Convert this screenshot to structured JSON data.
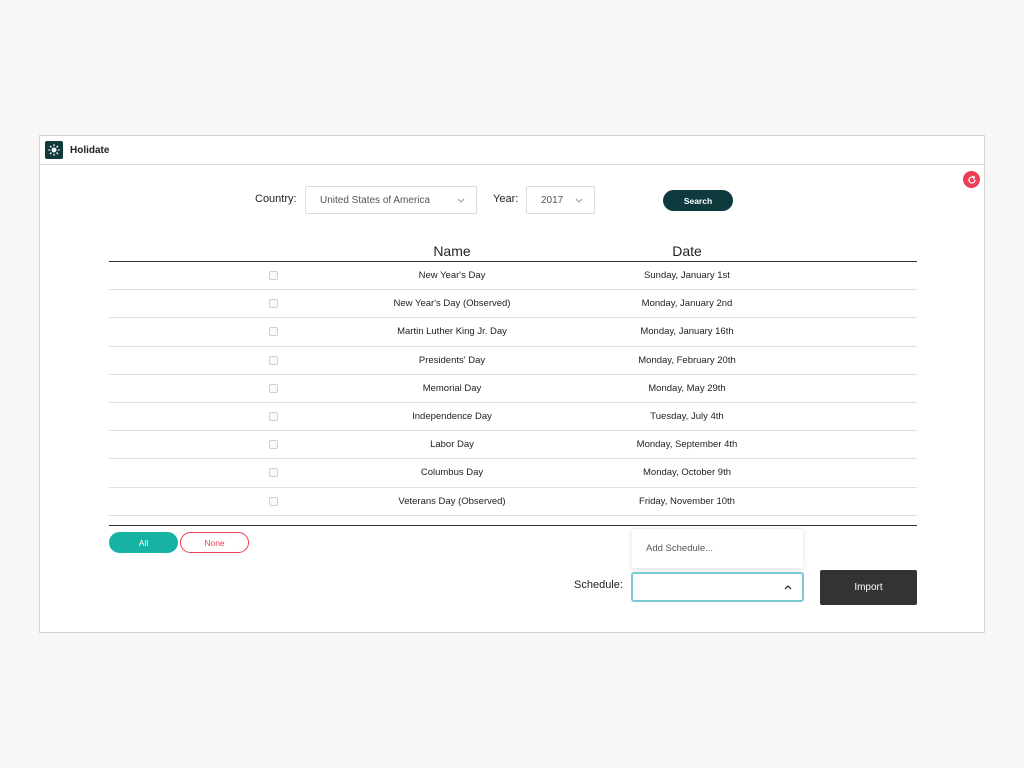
{
  "app": {
    "title": "Holidate",
    "logo_icon": "sun-icon",
    "accent": "#0d3a3c"
  },
  "filters": {
    "country_label": "Country:",
    "country_value": "United States of America",
    "year_label": "Year:",
    "year_value": "2017",
    "search_label": "Search"
  },
  "table": {
    "columns": [
      "Name",
      "Date"
    ],
    "rows": [
      {
        "name": "New Year's Day",
        "date": "Sunday, January 1st"
      },
      {
        "name": "New Year's Day (Observed)",
        "date": "Monday, January 2nd"
      },
      {
        "name": "Martin Luther King Jr. Day",
        "date": "Monday, January 16th"
      },
      {
        "name": "Presidents' Day",
        "date": "Monday, February 20th"
      },
      {
        "name": "Memorial Day",
        "date": "Monday, May 29th"
      },
      {
        "name": "Independence Day",
        "date": "Tuesday, July 4th"
      },
      {
        "name": "Labor Day",
        "date": "Monday, September 4th"
      },
      {
        "name": "Columbus Day",
        "date": "Monday, October 9th"
      },
      {
        "name": "Veterans Day (Observed)",
        "date": "Friday, November 10th"
      }
    ]
  },
  "selection": {
    "all_label": "All",
    "none_label": "None",
    "all_color": "#16b3a5",
    "none_color": "#ea3f55"
  },
  "schedule": {
    "label": "Schedule:",
    "dropdown_option": "Add Schedule...",
    "value": "",
    "import_label": "Import"
  }
}
